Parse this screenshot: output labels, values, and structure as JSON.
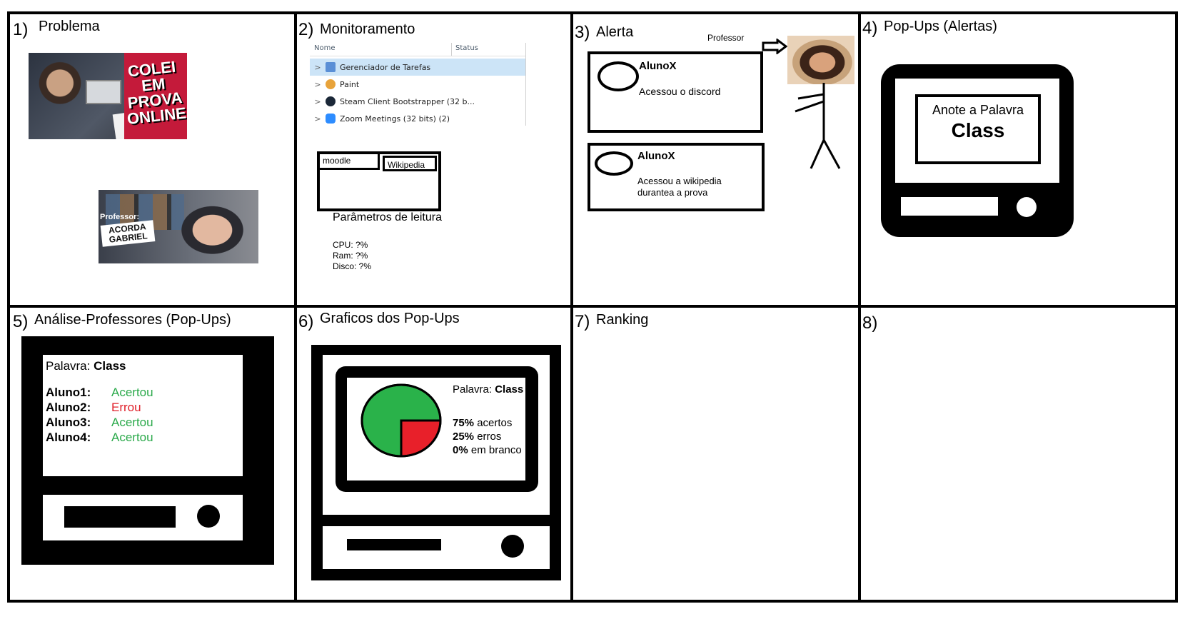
{
  "panels": [
    {
      "number": "1)",
      "title": "Problema"
    },
    {
      "number": "2)",
      "title": "Monitoramento"
    },
    {
      "number": "3)",
      "title": "Alerta"
    },
    {
      "number": "4)",
      "title": "Pop-Ups (Alertas)"
    },
    {
      "number": "5)",
      "title": "Análise-Professores (Pop-Ups)"
    },
    {
      "number": "6)",
      "title": "Graficos dos Pop-Ups"
    },
    {
      "number": "7)",
      "title": "Ranking"
    },
    {
      "number": "8)",
      "title": ""
    }
  ],
  "problema": {
    "thumb1_text": "COLEI EM PROVA ONLINE",
    "thumb2_caption": "Professor:",
    "thumb2_text": "ACORDA GABRIEL"
  },
  "monitoramento": {
    "columns": [
      "Nome",
      "Status"
    ],
    "processes": [
      {
        "name": "Gerenciador de Tarefas",
        "icon_color": "#5a8fd6"
      },
      {
        "name": "Paint",
        "icon_color": "#e8a33a"
      },
      {
        "name": "Steam Client Bootstrapper (32 b...",
        "icon_color": "#1b2838"
      },
      {
        "name": "Zoom Meetings (32 bits) (2)",
        "icon_color": "#2d8cff"
      }
    ],
    "browser_tabs": [
      "moodle",
      "Wikipedia"
    ],
    "params_title": "Parâmetros de leitura",
    "params": [
      "CPU: ?%",
      "Ram: ?%",
      "Disco: ?%"
    ]
  },
  "alerta": {
    "professor_label": "Professor",
    "alerts": [
      {
        "user": "AlunoX",
        "message": "Acessou o discord"
      },
      {
        "user": "AlunoX",
        "message": "Acessou a wikipedia\ndurantea a prova"
      }
    ]
  },
  "popups": {
    "line1": "Anote a Palavra",
    "word": "Class"
  },
  "analise": {
    "word_label": "Palavra:",
    "word": "Class",
    "students": [
      {
        "name": "Aluno1:",
        "result": "Acertou",
        "color": "#2aa94a"
      },
      {
        "name": "Aluno2:",
        "result": "Errou",
        "color": "#e0202a"
      },
      {
        "name": "Aluno3:",
        "result": "Acertou",
        "color": "#2aa94a"
      },
      {
        "name": "Aluno4:",
        "result": "Acertou",
        "color": "#2aa94a"
      }
    ]
  },
  "graficos": {
    "word_label": "Palavra:",
    "word": "Class",
    "stats": [
      {
        "value": "75%",
        "label": "acertos"
      },
      {
        "value": "25%",
        "label": "erros"
      },
      {
        "value": "0%",
        "label": "em branco"
      }
    ]
  },
  "chart_data": {
    "type": "pie",
    "categories": [
      "acertos",
      "erros",
      "em branco"
    ],
    "values": [
      75,
      25,
      0
    ],
    "colors": [
      "#2ab24a",
      "#e8202a",
      "#ffffff"
    ]
  }
}
